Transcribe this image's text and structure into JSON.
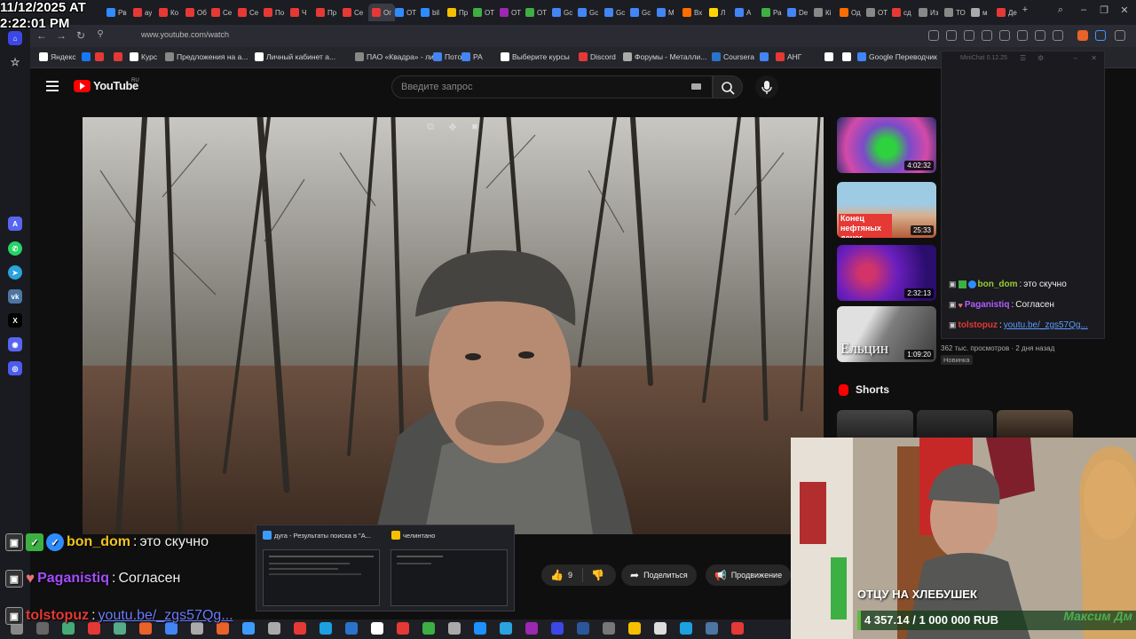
{
  "overlay": {
    "clock_date": "11/12/2025 AT",
    "clock_time": "2:22:01 PM"
  },
  "browser": {
    "url": "www.youtube.com/watch",
    "tabs": [
      {
        "label": "Рв",
        "color": "#2f8cff"
      },
      {
        "label": "ау",
        "color": "#e53935"
      },
      {
        "label": "Ко",
        "color": "#e53935"
      },
      {
        "label": "Об",
        "color": "#e53935"
      },
      {
        "label": "Се",
        "color": "#e53935"
      },
      {
        "label": "Се",
        "color": "#e53935"
      },
      {
        "label": "По",
        "color": "#e53935"
      },
      {
        "label": "Ч",
        "color": "#e53935"
      },
      {
        "label": "Пр",
        "color": "#e53935"
      },
      {
        "label": "Се",
        "color": "#e53935"
      },
      {
        "label": "Ог",
        "color": "#e53935"
      },
      {
        "label": "ОТ",
        "color": "#2f8cff"
      },
      {
        "label": "bil",
        "color": "#2f8cff"
      },
      {
        "label": "Пр",
        "color": "#f6c000"
      },
      {
        "label": "ОТ",
        "color": "#3cb043"
      },
      {
        "label": "ОТ",
        "color": "#9c27b0"
      },
      {
        "label": "ОТ",
        "color": "#3cb043"
      },
      {
        "label": "Gc",
        "color": "#4285f4"
      },
      {
        "label": "Gc",
        "color": "#4285f4"
      },
      {
        "label": "Gc",
        "color": "#4285f4"
      },
      {
        "label": "Gc",
        "color": "#4285f4"
      },
      {
        "label": "М",
        "color": "#4285f4"
      },
      {
        "label": "Вх",
        "color": "#ff6d00"
      },
      {
        "label": "Л",
        "color": "#ffd600"
      },
      {
        "label": "А",
        "color": "#4285f4"
      },
      {
        "label": "Ра",
        "color": "#3cb043"
      },
      {
        "label": "De",
        "color": "#4285f4"
      },
      {
        "label": "Кі",
        "color": "#888888"
      },
      {
        "label": "Од",
        "color": "#ff6d00"
      },
      {
        "label": "ОТ",
        "color": "#888888"
      },
      {
        "label": "сд",
        "color": "#e53935"
      },
      {
        "label": "Из",
        "color": "#888888"
      },
      {
        "label": "ТО",
        "color": "#888888"
      },
      {
        "label": "м",
        "color": "#aaaaaa"
      },
      {
        "label": "Де",
        "color": "#e53935"
      }
    ],
    "bookmarks": [
      {
        "label": "Яндекс",
        "color": "#ffffff"
      },
      {
        "label": "",
        "color": "#1877f2"
      },
      {
        "label": "",
        "color": "#e53935"
      },
      {
        "label": "",
        "color": "#e53935"
      },
      {
        "label": "Курс",
        "color": "#ffffff"
      },
      {
        "label": "Предложения на а...",
        "color": "#888888"
      },
      {
        "label": "Личный кабинет а...",
        "color": "#ffffff"
      },
      {
        "label": "ПАО «Квадра» - ли...",
        "color": "#888888"
      },
      {
        "label": "Поток",
        "color": "#4285f4"
      },
      {
        "label": "РА",
        "color": "#4285f4"
      },
      {
        "label": "Выберите курсы",
        "color": "#ffffff"
      },
      {
        "label": "Discord",
        "color": "#e53935"
      },
      {
        "label": "Форумы - Металли...",
        "color": "#aaaaaa"
      },
      {
        "label": "Coursera",
        "color": "#2a73cc"
      },
      {
        "label": "",
        "color": "#4285f4"
      },
      {
        "label": "АНГ",
        "color": "#e53935"
      },
      {
        "label": "",
        "color": "#ffffff"
      },
      {
        "label": "",
        "color": "#ffffff"
      },
      {
        "label": "Google Переводчик",
        "color": "#4285f4"
      }
    ]
  },
  "youtube": {
    "logo_text": "YouTube",
    "region": "RU",
    "search_placeholder": "Введите запрос",
    "likes": "9",
    "share_label": "Поделиться",
    "promote_label": "Продвижение",
    "suggestions": [
      {
        "duration": "4:02:32",
        "thumb_title": ""
      },
      {
        "duration": "25:33",
        "thumb_title": "Конец нефтяных денег"
      },
      {
        "duration": "2:32:13",
        "thumb_title": ""
      },
      {
        "duration": "1:09:20",
        "thumb_title": "Ельцин"
      }
    ],
    "views_meta": "362 тыс. просмотров · 2 дня назад",
    "new_badge": "Новинка",
    "shorts_label": "Shorts"
  },
  "minichat": {
    "title": "MiniChat 0.12.25",
    "messages": [
      {
        "user": "bon_dom",
        "text": "это скучно",
        "color": "#9acd32"
      },
      {
        "user": "Paganistiq",
        "text": "Согласен",
        "color": "#b35dff"
      },
      {
        "user": "tolstopuz",
        "text": "youtu.be/_zgs57Qg...",
        "color": "#e53935"
      }
    ]
  },
  "stream_chat": {
    "messages": [
      {
        "user": "bon_dom",
        "text": "это скучно",
        "color": "#f0c419"
      },
      {
        "user": "Paganistiq",
        "text": "Согласен",
        "color": "#a44dff"
      },
      {
        "user": "tolstopuz",
        "text": "youtu.be/_zgs57Qg...",
        "color": "#e53935"
      }
    ]
  },
  "task_preview": {
    "items": [
      {
        "title": "дуга - Результаты поиска в \"А...",
        "color": "#3d9bff"
      },
      {
        "title": "челинтано",
        "color": "#f6c000"
      }
    ]
  },
  "webcam": {
    "caption": "ОТЦУ НА ХЛЕБУШЕК",
    "donation": "4 357.14 / 1 000 000 RUB",
    "donation_progress": 0.0044,
    "donation_name": "Максим Дм"
  }
}
